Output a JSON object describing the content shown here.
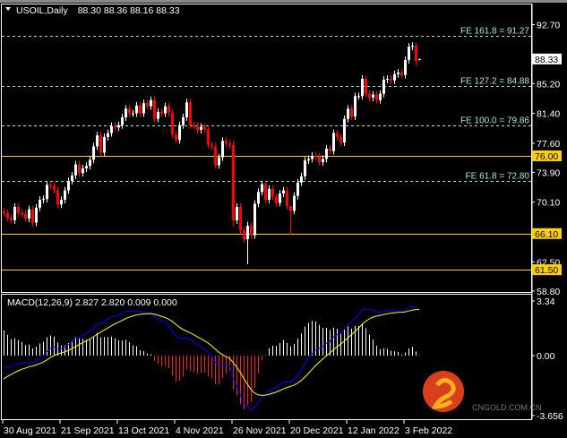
{
  "header": {
    "symbol": "USOIL,Daily",
    "ohlc": "88.30 88.36 88.16 88.33"
  },
  "macd_header": "MACD(12,26,9) 2.827 2.820 0.009 0.000",
  "colors": {
    "bull": "#ffffff",
    "bear": "#ff0000",
    "level": "#ffd000",
    "fib": "#a8e4e4",
    "macd_line": "#0000ff",
    "signal_line": "#ffff00",
    "hist_pos": "#ffffff",
    "hist_neg": "#ff2020",
    "doji_marker": "#00c000"
  },
  "price_axis": {
    "ticks": [
      "92.70",
      "85.20",
      "81.40",
      "77.60",
      "73.90",
      "70.10",
      "62.50",
      "58.80"
    ],
    "current_price": "88.33"
  },
  "macd_axis": {
    "ticks": [
      "3.34",
      "0.00",
      "-3.656"
    ]
  },
  "levels": [
    {
      "value": 76.0,
      "label": "76.00"
    },
    {
      "value": 66.1,
      "label": "66.10"
    },
    {
      "value": 61.5,
      "label": "61.50"
    }
  ],
  "fib_lines": [
    {
      "value": 91.27,
      "label": "FE 161.8 = 91.27"
    },
    {
      "value": 84.88,
      "label": "FE 127.2 = 84.88"
    },
    {
      "value": 79.86,
      "label": "FE 100.0 = 79.86"
    },
    {
      "value": 72.8,
      "label": "FE 61.8 = 72.80"
    }
  ],
  "date_labels": [
    {
      "bar": 0,
      "label": "30 Aug 2021"
    },
    {
      "bar": 16,
      "label": "21 Sep 2021"
    },
    {
      "bar": 32,
      "label": "13 Oct 2021"
    },
    {
      "bar": 48,
      "label": "4 Nov 2021"
    },
    {
      "bar": 64,
      "label": "26 Nov 2021"
    },
    {
      "bar": 80,
      "label": "20 Dec 2021"
    },
    {
      "bar": 96,
      "label": "12 Jan 2022"
    },
    {
      "bar": 112,
      "label": "3 Feb 2022"
    }
  ],
  "watermark": {
    "logo_cn": "中金网",
    "domain": "CNGOLD.COM.CN",
    "tagline": "中 文 财 经 新 媒 体"
  },
  "chart_data": {
    "type": "candlestick",
    "title": "USOIL,Daily",
    "ylim": [
      58.8,
      92.7
    ],
    "close": [
      68.7,
      68.1,
      67.8,
      69.5,
      68.7,
      68.6,
      68.0,
      69.2,
      67.5,
      69.4,
      70.4,
      70.5,
      72.3,
      72.2,
      71.6,
      69.8,
      70.4,
      71.6,
      72.8,
      73.5,
      74.9,
      73.8,
      74.4,
      74.7,
      75.5,
      77.2,
      78.6,
      76.4,
      78.4,
      78.9,
      79.8,
      79.6,
      79.9,
      80.9,
      82.0,
      81.4,
      81.4,
      82.4,
      81.4,
      82.7,
      82.3,
      83.1,
      80.7,
      81.6,
      81.4,
      82.3,
      81.5,
      78.7,
      78.0,
      79.9,
      80.9,
      82.8,
      79.9,
      79.8,
      79.3,
      79.7,
      79.4,
      77.4,
      77.2,
      74.8,
      75.8,
      77.9,
      77.6,
      77.4,
      67.8,
      69.5,
      66.5,
      65.4,
      67.1,
      65.9,
      69.9,
      71.4,
      72.4,
      70.4,
      71.8,
      70.8,
      70.0,
      71.2,
      71.6,
      69.6,
      69.0,
      70.9,
      72.6,
      73.4,
      75.4,
      75.6,
      76.0,
      75.9,
      75.2,
      75.6,
      76.9,
      76.6,
      78.9,
      78.4,
      77.7,
      80.7,
      82.0,
      81.0,
      83.6,
      83.6,
      85.8,
      83.9,
      83.4,
      83.8,
      83.1,
      83.9,
      85.7,
      85.8,
      85.6,
      86.4,
      86.6,
      86.3,
      88.2,
      89.9,
      90.0,
      88.1,
      88.33
    ],
    "first_open": 68.9,
    "wick_overrides": {
      "64": {
        "high": 77.9,
        "low": 67.0
      },
      "68": {
        "high": 67.6,
        "low": 62.2
      },
      "80": {
        "high": 69.4,
        "low": 65.9
      },
      "115": {
        "high": 90.4,
        "low": 87.5
      },
      "116": {
        "open": 88.3,
        "high": 88.36,
        "low": 88.16
      }
    },
    "macd": {
      "fast": 12,
      "slow": 26,
      "signal": 9,
      "ylim": [
        -3.656,
        3.34
      ]
    }
  }
}
